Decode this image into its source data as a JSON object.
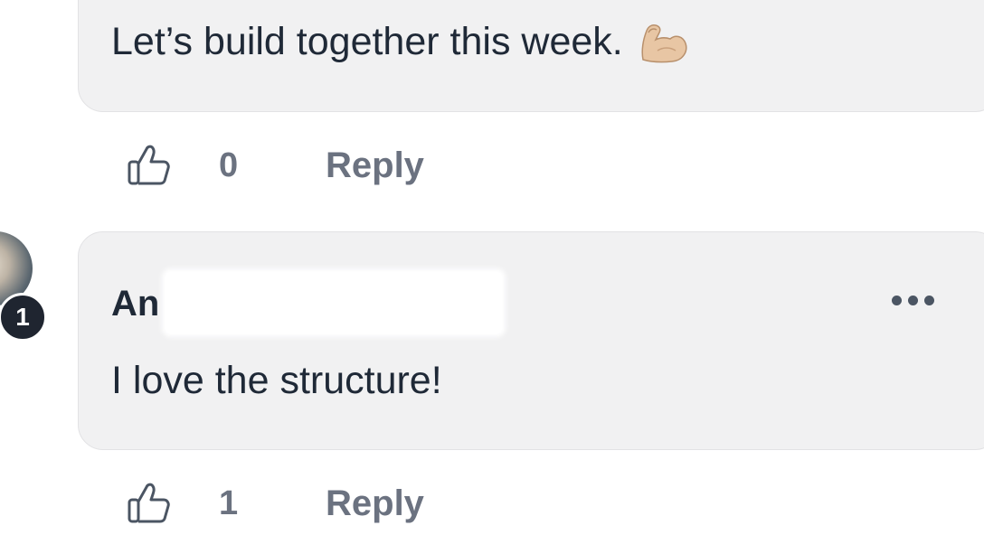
{
  "comments": [
    {
      "text": "Let’s build together this week.",
      "emoji_icon": "flexed-biceps-icon",
      "like_count": "0",
      "reply_label": "Reply"
    },
    {
      "author_visible": "An",
      "text": "I love the structure!",
      "badge": "1",
      "like_count": "1",
      "reply_label": "Reply"
    }
  ],
  "colors": {
    "bubble_bg": "#f1f1f2",
    "text": "#1f2937",
    "muted": "#6b7280",
    "badge_bg": "#1f2530"
  }
}
